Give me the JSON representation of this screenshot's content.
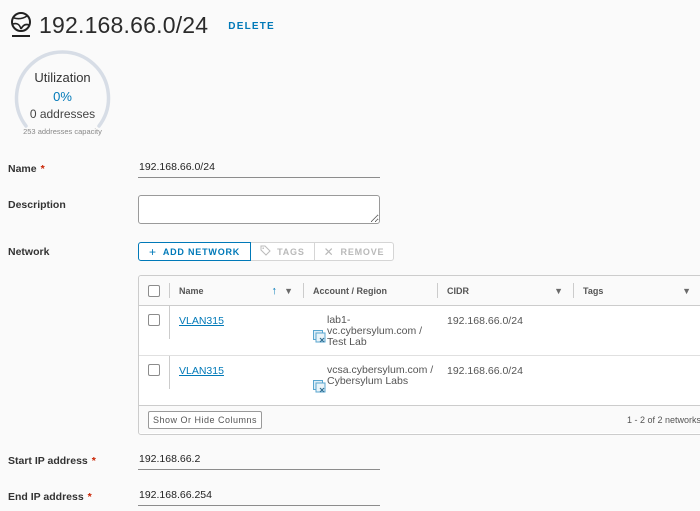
{
  "header": {
    "icon": "network-globe-icon",
    "title": "192.168.66.0/24",
    "delete_label": "DELETE"
  },
  "utilization": {
    "label": "Utilization",
    "percent": "0%",
    "percent_value": 0,
    "addresses": "0 addresses",
    "capacity": "253 addresses capacity"
  },
  "form": {
    "name": {
      "label": "Name",
      "required_marker": "*",
      "value": "192.168.66.0/24"
    },
    "description": {
      "label": "Description",
      "value": ""
    },
    "network": {
      "label": "Network",
      "buttons": [
        {
          "icon": "plus-icon",
          "label": "ADD NETWORK",
          "enabled": true
        },
        {
          "icon": "tag-icon",
          "label": "TAGS",
          "enabled": false
        },
        {
          "icon": "close-icon",
          "label": "REMOVE",
          "enabled": false
        }
      ]
    },
    "start_ip": {
      "label": "Start IP address",
      "required_marker": "*",
      "value": "192.168.66.2"
    },
    "end_ip": {
      "label": "End IP address",
      "required_marker": "*",
      "value": "192.168.66.254"
    }
  },
  "grid": {
    "columns": [
      "Name",
      "Account / Region",
      "CIDR",
      "Tags"
    ],
    "sort_icon": "arrow-up-icon",
    "filter_icon": "filter-icon",
    "rows": [
      {
        "name": "VLAN315",
        "account_icon": "vcenter-icon",
        "account": "lab1-vc.cybersylum.com / Test Lab",
        "cidr": "192.168.66.0/24",
        "tags": ""
      },
      {
        "name": "VLAN315",
        "account_icon": "vcenter-icon",
        "account": "vcsa.cybersylum.com / Cybersylum Labs",
        "cidr": "192.168.66.0/24",
        "tags": ""
      }
    ],
    "footer": {
      "columns_button": "Show Or Hide Columns",
      "count": "1 - 2 of 2 networks"
    }
  },
  "colors": {
    "accent": "#0079b8",
    "required": "#c92100"
  }
}
